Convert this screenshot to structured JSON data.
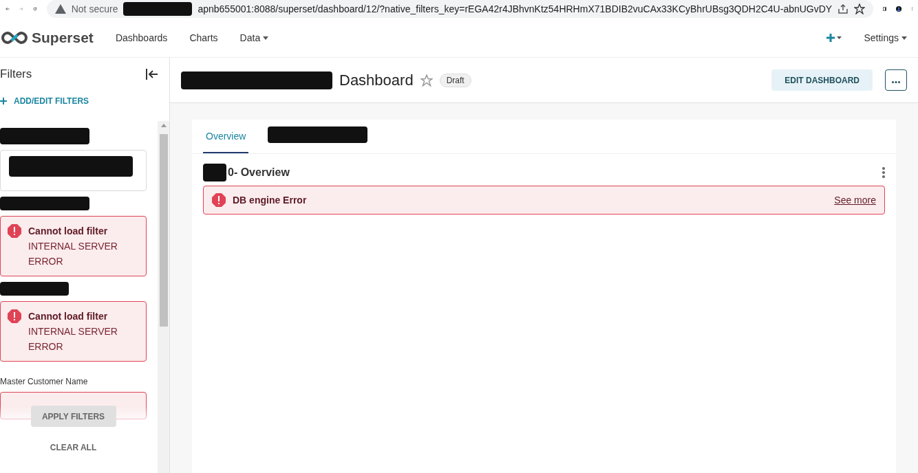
{
  "browser": {
    "security": "Not secure",
    "url": "apnb655001:8088/superset/dashboard/12/?native_filters_key=rEGA42r4JBhvnKtz54HRHmX71BDIB2vuCAx33KCyBhrUBsg3QDH2C4U-abnUGvDY"
  },
  "nav": {
    "brand": "Superset",
    "items": [
      {
        "label": "Dashboards",
        "dropdown": false
      },
      {
        "label": "Charts",
        "dropdown": false
      },
      {
        "label": "Data",
        "dropdown": true
      }
    ],
    "settings": "Settings"
  },
  "filters": {
    "title": "Filters",
    "add": "ADD/EDIT FILTERS",
    "items": [
      {
        "kind": "select"
      },
      {
        "kind": "error",
        "title": "Cannot load filter",
        "message": "INTERNAL SERVER ERROR"
      },
      {
        "kind": "error",
        "title": "Cannot load filter",
        "message": "INTERNAL SERVER ERROR"
      },
      {
        "kind": "partial",
        "label": "Master Customer Name"
      }
    ],
    "apply": "APPLY FILTERS",
    "clear": "CLEAR ALL"
  },
  "dashboard": {
    "title": "Dashboard",
    "starred": false,
    "status": "Draft",
    "edit": "EDIT DASHBOARD",
    "tabs": [
      {
        "label": "Overview",
        "selected": true
      },
      {
        "selected": false
      }
    ],
    "chart": {
      "title": "0- Overview",
      "error": "DB engine Error",
      "link": "See more"
    }
  }
}
